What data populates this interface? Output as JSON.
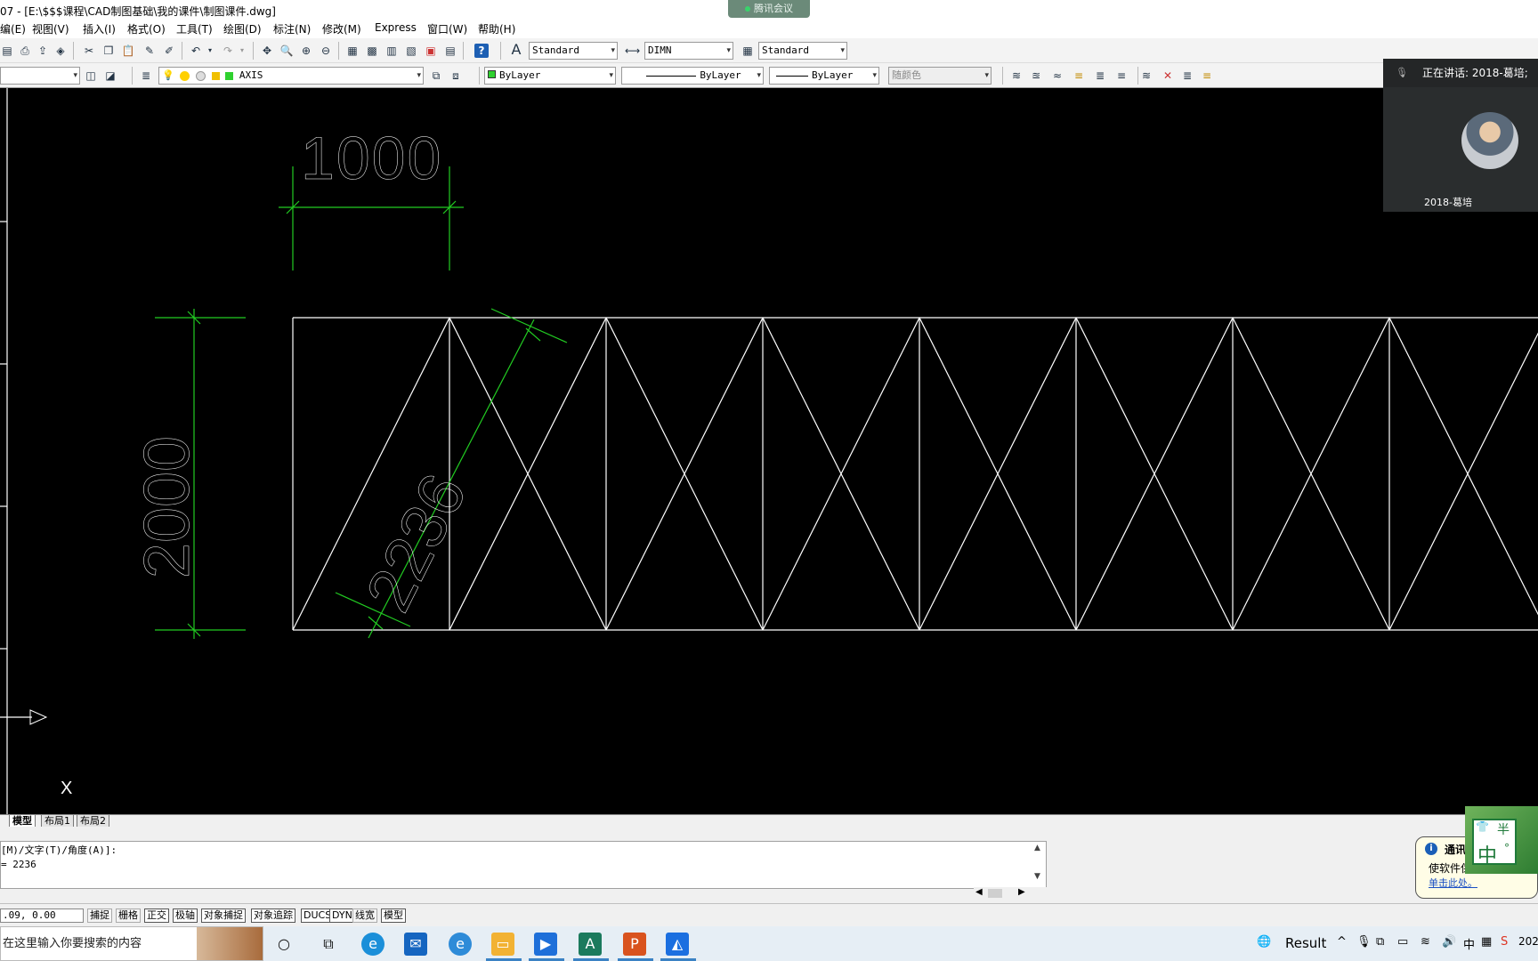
{
  "window": {
    "title": "07 - [E:\\$$$课程\\CAD制图基础\\我的课件\\制图课件.dwg]"
  },
  "meeting_pill": {
    "label": "腾讯会议"
  },
  "menu": [
    "编(E)",
    "视图(V)",
    "插入(I)",
    "格式(O)",
    "工具(T)",
    "绘图(D)",
    "标注(N)",
    "修改(M)",
    "Express",
    "窗口(W)",
    "帮助(H)"
  ],
  "toolbar1": {
    "text_style": "Standard",
    "dim_style": "DIMN",
    "table_style": "Standard"
  },
  "toolbar2": {
    "layer": "AXIS",
    "color": "ByLayer",
    "linetype": "ByLayer",
    "lineweight": "ByLayer",
    "plotstyle": "随颜色"
  },
  "drawing": {
    "dim_horizontal": "1000",
    "dim_vertical": "2000",
    "dim_aligned": "2236",
    "ucs_axis_label": "X",
    "colors": {
      "geometry": "#ffffff",
      "dimension": "#22cc22",
      "background": "#000000"
    },
    "truss": {
      "panel_width": 1000,
      "height": 2000,
      "panels_visible": 8
    }
  },
  "meeting_panel": {
    "speaking": "正在讲话: 2018-葛培;",
    "participant": "2018-葛培"
  },
  "layout_tabs": [
    "模型",
    "布局1",
    "布局2"
  ],
  "command": {
    "line1": "[M)/文字(T)/角度(A)]:",
    "line2": "= 2236"
  },
  "notification": {
    "title": "通讯",
    "body": "使软件保",
    "link": "单击此处。"
  },
  "ime": {
    "top": "半",
    "main": "中",
    "extra": "°"
  },
  "status": {
    "coords": ".09, 0.00",
    "buttons": [
      "捕捉",
      "栅格",
      "正交",
      "极轴",
      "对象捕捉",
      "对象追踪",
      "DUCS",
      "DYN",
      "线宽",
      "模型"
    ]
  },
  "taskbar": {
    "search_placeholder": "在这里输入你要搜索的内容",
    "tray_result": "Result",
    "tray_ime": "中",
    "time_partial": "202"
  }
}
